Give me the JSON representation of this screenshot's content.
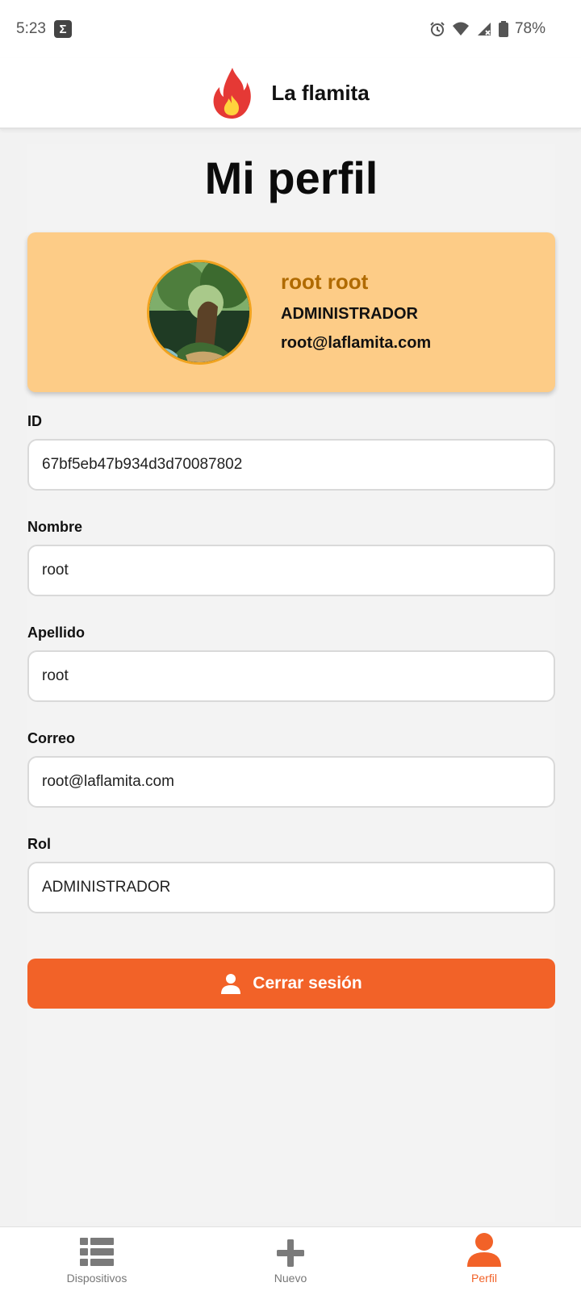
{
  "status_bar": {
    "time": "5:23",
    "battery": "78%"
  },
  "app": {
    "title": "La flamita"
  },
  "page": {
    "title": "Mi perfil"
  },
  "profile_card": {
    "name": "root root",
    "role": "ADMINISTRADOR",
    "email": "root@laflamita.com"
  },
  "fields": [
    {
      "label": "ID",
      "value": "67bf5eb47b934d3d70087802"
    },
    {
      "label": "Nombre",
      "value": "root"
    },
    {
      "label": "Apellido",
      "value": "root"
    },
    {
      "label": "Correo",
      "value": "root@laflamita.com"
    },
    {
      "label": "Rol",
      "value": "ADMINISTRADOR"
    }
  ],
  "logout_button": {
    "label": "Cerrar sesión",
    "icon": "person-icon"
  },
  "bottom_nav": [
    {
      "label": "Dispositivos",
      "icon": "list-icon",
      "active": false
    },
    {
      "label": "Nuevo",
      "icon": "plus-icon",
      "active": false
    },
    {
      "label": "Perfil",
      "icon": "person-icon",
      "active": true
    }
  ],
  "colors": {
    "accent": "#f26228",
    "card_background": "#fdcc87",
    "card_name": "#b06a00",
    "avatar_ring": "#f0a31f"
  }
}
